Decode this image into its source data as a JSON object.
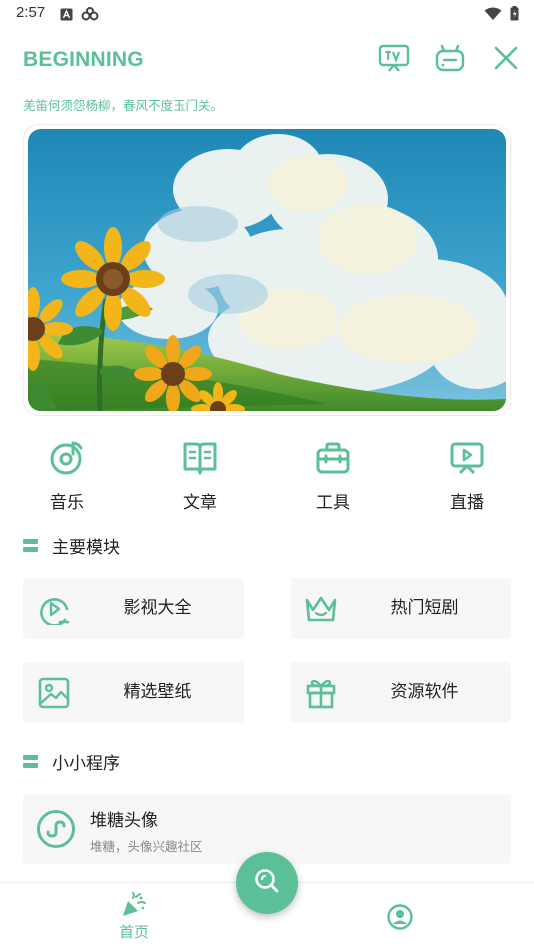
{
  "status_bar": {
    "time": "2:57"
  },
  "header": {
    "brand": "BEGINNING",
    "subtitle": "羌笛何须怨杨柳，春风不度玉门关。",
    "actions": [
      "tv-icon",
      "robot-icon",
      "close-icon"
    ]
  },
  "quick_nav": [
    {
      "label": "音乐",
      "icon": "music-disc-icon"
    },
    {
      "label": "文章",
      "icon": "book-icon"
    },
    {
      "label": "工具",
      "icon": "toolbox-icon"
    },
    {
      "label": "直播",
      "icon": "live-play-icon"
    }
  ],
  "sections": {
    "main_modules": "主要模块",
    "mini_programs": "小小程序"
  },
  "modules": [
    {
      "label": "影视大全",
      "icon": "play-circle-icon"
    },
    {
      "label": "热门短剧",
      "icon": "crown-icon"
    },
    {
      "label": "精选壁纸",
      "icon": "image-icon"
    },
    {
      "label": "资源软件",
      "icon": "gift-icon"
    }
  ],
  "mini_program": {
    "title": "堆糖头像",
    "description": "堆糖，头像兴趣社区",
    "icon": "mini-program-icon"
  },
  "bottom_nav": {
    "home_label": "首页",
    "home_icon": "party-popper-icon",
    "profile_icon": "user-circle-icon",
    "fab_icon": "search-icon"
  },
  "colors": {
    "accent": "#5bbf98",
    "card_bg": "#f7f7f7",
    "text": "#222222",
    "muted": "#888888"
  }
}
